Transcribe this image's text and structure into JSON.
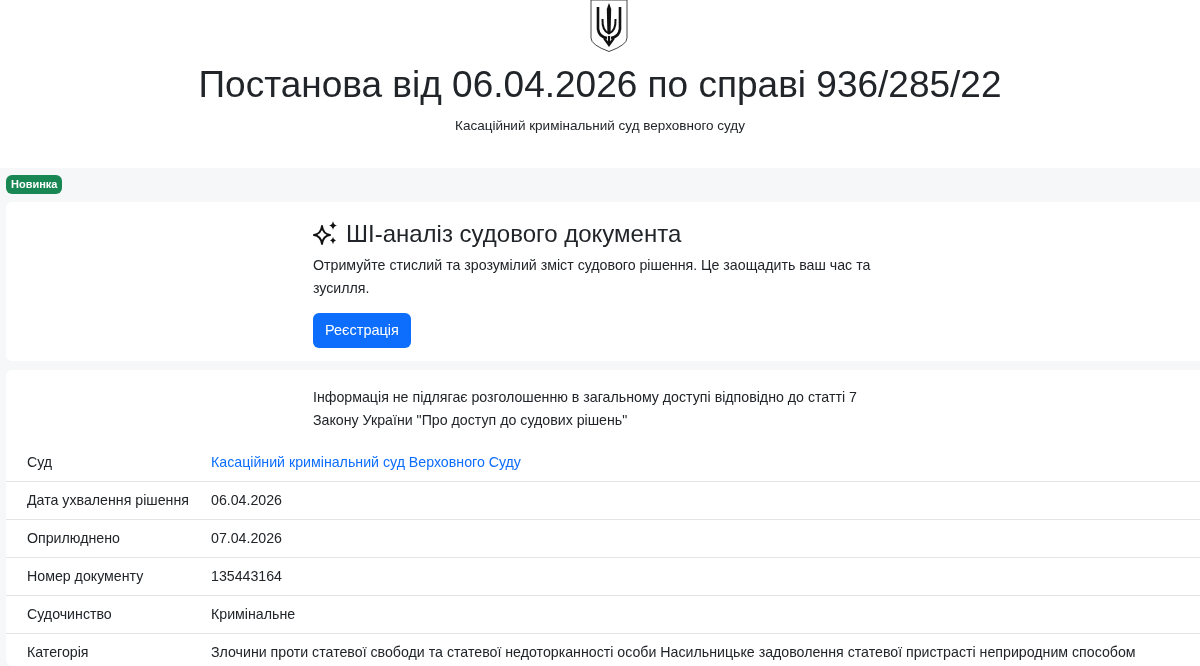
{
  "header": {
    "title": "Постанова від 06.04.2026 по справі 936/285/22",
    "subtitle": "Касаційний кримінальний суд верховного суду"
  },
  "ai_promo": {
    "badge": "Новинка",
    "title": "ШІ-аналіз судового документа",
    "text": "Отримуйте стислий та зрозумілий зміст судового рішення. Це заощадить ваш час та зусилля.",
    "button": "Реєстрація"
  },
  "document": {
    "notice": "Інформація не підлягає розголошенню в загальному доступі відповідно до статті 7 Закону України \"Про доступ до судових рішень\"",
    "rows": [
      {
        "label": "Суд",
        "value": "Касаційний кримінальний суд Верховного Суду",
        "kind": "link"
      },
      {
        "label": "Дата ухвалення рішення",
        "value": "06.04.2026",
        "kind": "text"
      },
      {
        "label": "Оприлюднено",
        "value": "07.04.2026",
        "kind": "text"
      },
      {
        "label": "Номер документу",
        "value": "135443164",
        "kind": "text"
      },
      {
        "label": "Судочинство",
        "value": "Кримінальне",
        "kind": "text"
      },
      {
        "label": "Категорія",
        "value": "Злочини проти статевої свободи та статевої недоторканності особи Насильницьке задоволення статевої пристрасті неприродним способом",
        "kind": "text"
      }
    ]
  }
}
